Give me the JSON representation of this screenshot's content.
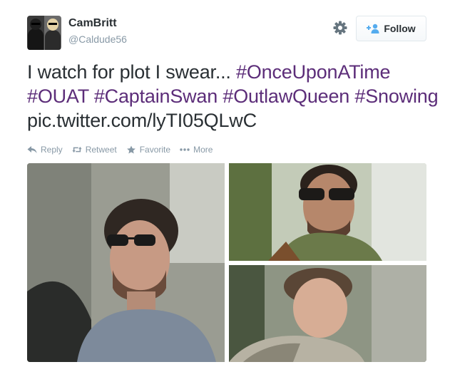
{
  "user": {
    "display_name": "CamBritt",
    "handle": "@Caldude56"
  },
  "header": {
    "follow_label": "Follow",
    "settings_icon": "gear-icon",
    "follow_icon": "person-add-icon"
  },
  "tweet": {
    "text_plain": "I watch for plot I swear... ",
    "hashtags": [
      "#OnceUponATime",
      "#OUAT",
      "#CaptainSwan",
      "#OutlawQueen",
      "#Snowing"
    ],
    "link": "pic.twitter.com/lyTI05QLwC",
    "hashtag_color": "#5c2d79"
  },
  "actions": {
    "reply": "Reply",
    "retweet": "Retweet",
    "favorite": "Favorite",
    "more": "More"
  },
  "media": {
    "images": [
      "photo-man-sunglasses-gray-shirt",
      "photo-man-sunglasses-scarf",
      "photo-man-profile"
    ]
  }
}
